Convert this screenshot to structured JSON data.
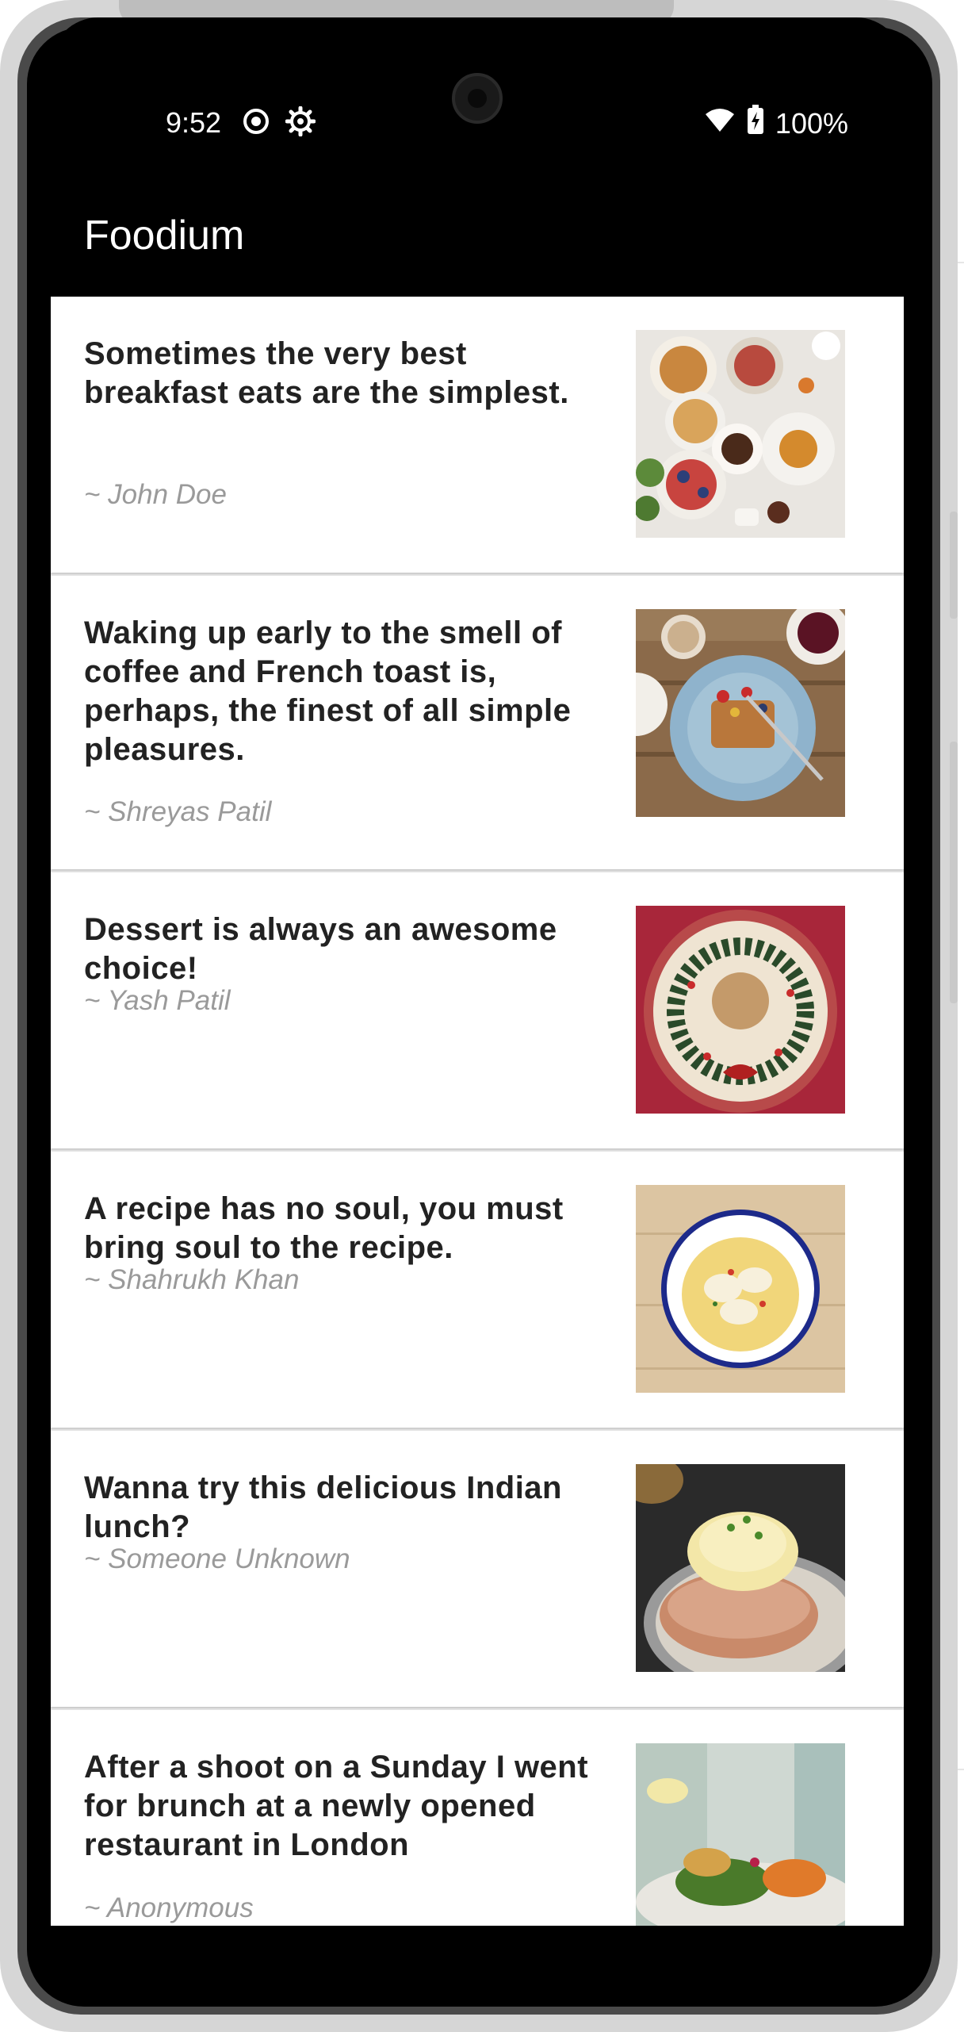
{
  "status_bar": {
    "time": "9:52",
    "battery": "100%",
    "icons": [
      "record-icon",
      "settings-gear-icon",
      "wifi-icon",
      "battery-charging-icon"
    ]
  },
  "app_bar": {
    "title": "Foodium"
  },
  "posts": [
    {
      "title": "Sometimes the very best breakfast eats are the simplest.",
      "author": "~ John Doe",
      "image": "breakfast-spread-image"
    },
    {
      "title": "Waking up early to the smell of coffee and French toast is, perhaps, the finest of all simple pleasures.",
      "author": "~ Shreyas Patil",
      "image": "french-toast-image"
    },
    {
      "title": "Dessert is always an awesome choice!",
      "author": "~ Yash Patil",
      "image": "dessert-image"
    },
    {
      "title": "A recipe has no soul, you must bring soul to the recipe.",
      "author": "~ Shahrukh Khan",
      "image": "soup-bowl-image"
    },
    {
      "title": "Wanna try this delicious Indian lunch?",
      "author": "~ Someone Unknown",
      "image": "indian-lunch-image"
    },
    {
      "title": "After a shoot on a Sunday I went for brunch at a newly opened restaurant in London",
      "author": "~ Anonymous",
      "image": "brunch-image"
    }
  ],
  "colors": {
    "app_bar": "#000000",
    "card_bg": "#ffffff",
    "title_text": "#222222",
    "author_text": "#9a9a9a"
  }
}
